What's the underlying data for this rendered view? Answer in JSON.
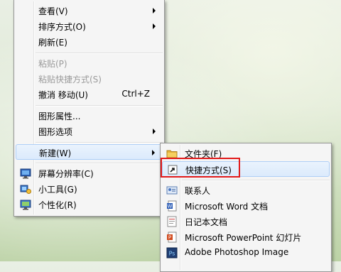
{
  "context_menu": {
    "items": [
      {
        "label": "查看(V)"
      },
      {
        "label": "排序方式(O)"
      },
      {
        "label": "刷新(E)"
      },
      {
        "label": "粘贴(P)"
      },
      {
        "label": "粘贴快捷方式(S)"
      },
      {
        "label": "撤消 移动(U)",
        "accel": "Ctrl+Z"
      },
      {
        "label": "图形属性..."
      },
      {
        "label": "图形选项"
      },
      {
        "label": "新建(W)"
      },
      {
        "label": "屏幕分辨率(C)"
      },
      {
        "label": "小工具(G)"
      },
      {
        "label": "个性化(R)"
      }
    ]
  },
  "new_submenu": {
    "items": [
      {
        "label": "文件夹(F)"
      },
      {
        "label": "快捷方式(S)"
      },
      {
        "label": "联系人"
      },
      {
        "label": "Microsoft Word 文档"
      },
      {
        "label": "日记本文档"
      },
      {
        "label": "Microsoft PowerPoint 幻灯片"
      },
      {
        "label": "Adobe Photoshop Image"
      }
    ]
  },
  "colors": {
    "highlight_box": "#e21a1a",
    "hover_bg": "#dbeafc",
    "disabled_text": "#9a9a9a"
  }
}
